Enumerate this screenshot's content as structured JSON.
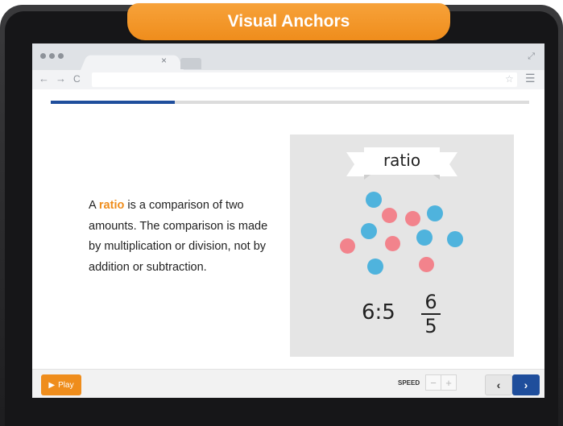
{
  "header": {
    "title": "Visual Anchors"
  },
  "browser": {
    "tab_close_icon": "×",
    "expand_icon": "⤢",
    "nav": {
      "back": "←",
      "forward": "→",
      "reload": "C"
    },
    "url_value": "",
    "star_icon": "☆",
    "menu_icon": "☰"
  },
  "lesson": {
    "progress_fraction": 0.26,
    "text_prefix": "A ",
    "keyword": "ratio",
    "text_suffix": " is a comparison of two amounts. The comparison is made by multiplication or division, not by addition or subtraction."
  },
  "illustration": {
    "banner_word": "ratio",
    "ratio_text": "6:5",
    "fraction": {
      "numerator": "6",
      "denominator": "5"
    },
    "dot_colors": {
      "blue": "#4fb3dd",
      "pink": "#f2838c"
    },
    "blue_count": 6,
    "pink_count": 5
  },
  "controls": {
    "play_icon": "▶",
    "play_label": "Play",
    "speed_label": "SPEED",
    "speed_minus": "−",
    "speed_plus": "+",
    "prev_icon": "‹",
    "next_icon": "›"
  },
  "colors": {
    "accent_orange": "#ef8d1c",
    "accent_blue": "#1f4e9c"
  }
}
